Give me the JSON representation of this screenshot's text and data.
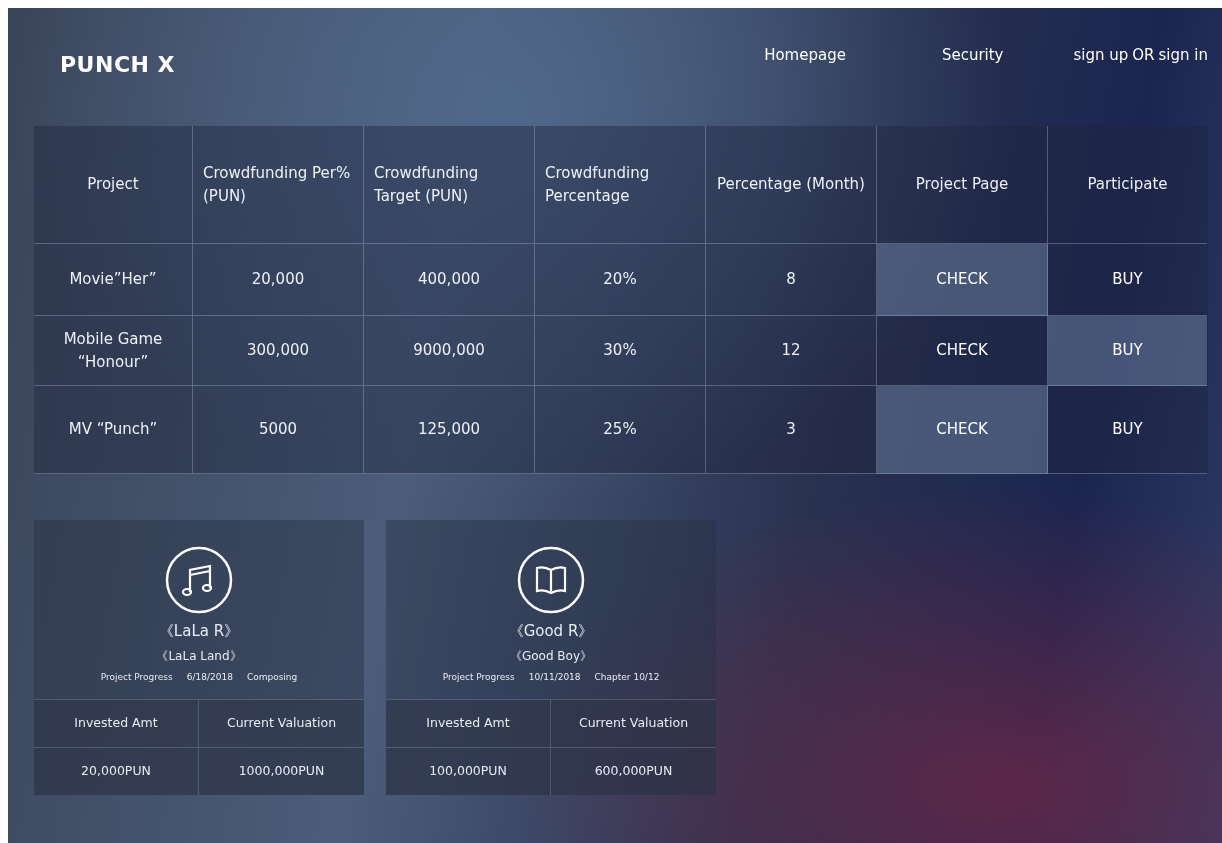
{
  "brand": "PUNCH X",
  "nav": [
    "Homepage",
    "Security"
  ],
  "auth": {
    "sign_up": "sign up",
    "separator": "OR",
    "sign_in": "sign in"
  },
  "table": {
    "columns": [
      "Project",
      "Crowdfunding Per%(PUN)",
      "Crowdfunding Target (PUN)",
      "Crowdfunding Percentage",
      "Percentage (Month)",
      "Project Page",
      "Participate"
    ],
    "rows": [
      {
        "project": "Movie”Her”",
        "per": "20,000",
        "target": "400,000",
        "percentage": "20%",
        "month": "8",
        "check": {
          "label": "CHECK",
          "highlighted": true
        },
        "buy": {
          "label": "BUY",
          "highlighted": false
        }
      },
      {
        "project": "Mobile Game “Honour”",
        "per": "300,000",
        "target": "9000,000",
        "percentage": "30%",
        "month": "12",
        "check": {
          "label": "CHECK",
          "highlighted": false
        },
        "buy": {
          "label": "BUY",
          "highlighted": true
        }
      },
      {
        "project": "MV “Punch”",
        "per": "5000",
        "target": "125,000",
        "percentage": "25%",
        "month": "3",
        "check": {
          "label": "CHECK",
          "highlighted": true
        },
        "buy": {
          "label": "BUY",
          "highlighted": false
        }
      }
    ]
  },
  "cards": [
    {
      "kind": "music",
      "title": "《LaLa R》",
      "subtitle": "《LaLa Land》",
      "progress_label": "Project Progress",
      "date": "6/18/2018",
      "stage": "Composing",
      "invested_label": "Invested Amt",
      "valuation_label": "Current Valuation",
      "invested": "20,000PUN",
      "valuation": "1000,000PUN"
    },
    {
      "kind": "book",
      "title": "《Good R》",
      "subtitle": "《Good Boy》",
      "progress_label": "Project Progress",
      "date": "10/11/2018",
      "stage": "Chapter 10/12",
      "invested_label": "Invested Amt",
      "valuation_label": "Current Valuation",
      "invested": "100,000PUN",
      "valuation": "600,000PUN"
    }
  ]
}
